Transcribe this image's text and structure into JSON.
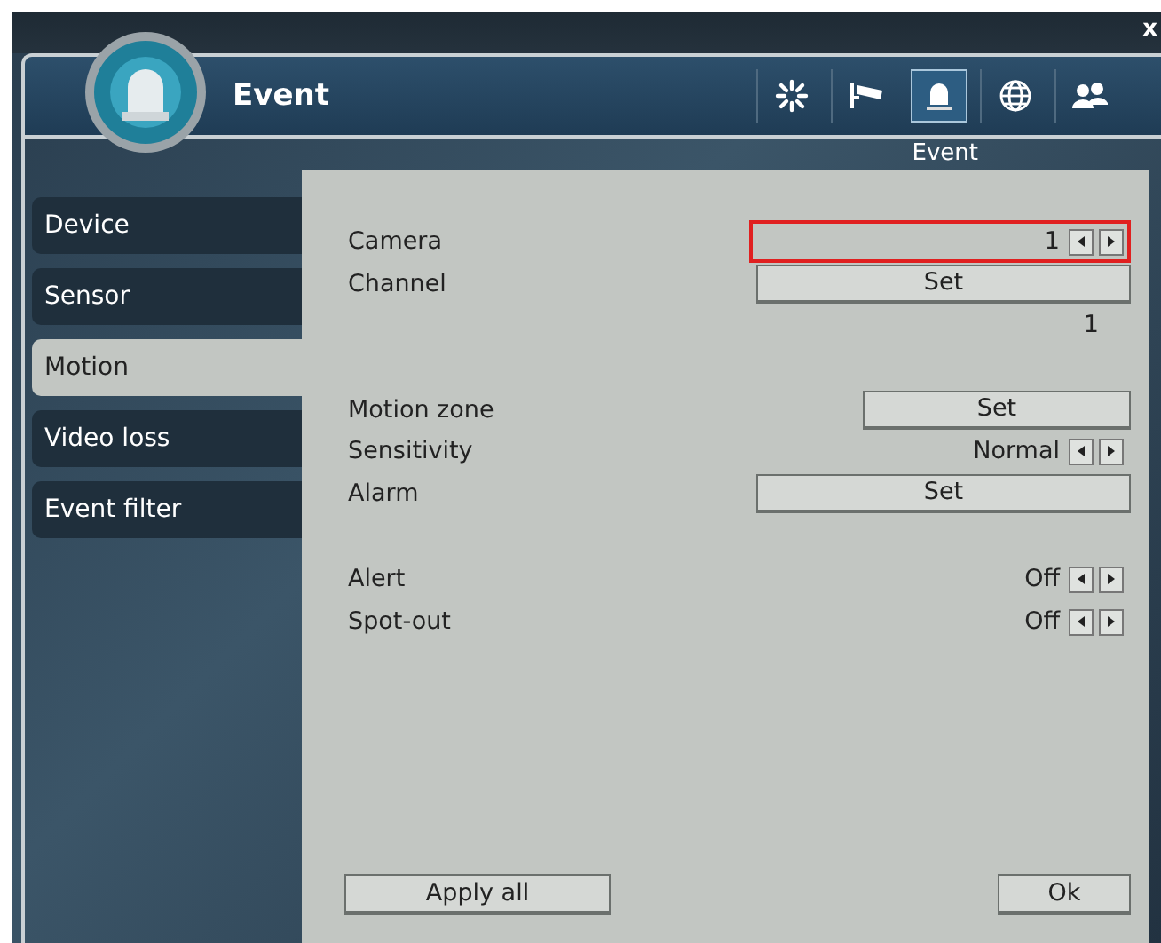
{
  "close_button": "x",
  "header": {
    "title": "Event"
  },
  "toolbar": [
    {
      "kind": "settings",
      "selected": false
    },
    {
      "kind": "camera",
      "selected": false
    },
    {
      "kind": "event",
      "selected": true
    },
    {
      "kind": "network",
      "selected": false
    },
    {
      "kind": "users",
      "selected": false
    }
  ],
  "section_title": "Event",
  "sidebar": {
    "items": [
      {
        "label": "Device",
        "selected": false
      },
      {
        "label": "Sensor",
        "selected": false
      },
      {
        "label": "Motion",
        "selected": true
      },
      {
        "label": "Video loss",
        "selected": false
      },
      {
        "label": "Event filter",
        "selected": false
      }
    ]
  },
  "groups": [
    [
      {
        "kind": "stepper",
        "label": "Camera",
        "value": "1",
        "focused": true
      },
      {
        "kind": "button",
        "label": "Channel",
        "button": "Set"
      },
      {
        "kind": "value",
        "value": "1"
      }
    ],
    [
      {
        "kind": "button_short",
        "label": "Motion zone",
        "button": "Set"
      },
      {
        "kind": "stepper",
        "label": "Sensitivity",
        "value": "Normal",
        "focused": false
      },
      {
        "kind": "button",
        "label": "Alarm",
        "button": "Set"
      }
    ],
    [
      {
        "kind": "stepper",
        "label": "Alert",
        "value": "Off",
        "focused": false
      },
      {
        "kind": "stepper",
        "label": "Spot-out",
        "value": "Off",
        "focused": false
      }
    ]
  ],
  "footer": {
    "apply_button": "Apply all",
    "ok_button": "Ok"
  }
}
